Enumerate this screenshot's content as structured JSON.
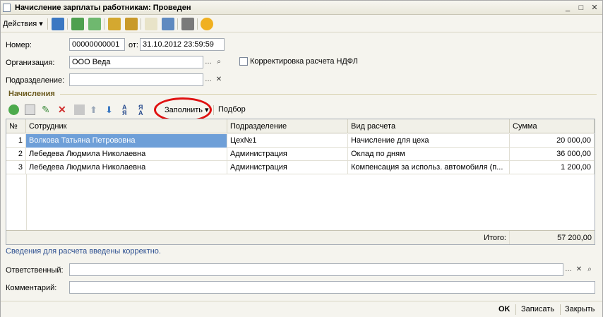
{
  "window": {
    "title": "Начисление зарплаты работникам: Проведен",
    "minimize_glyph": "_",
    "maximize_glyph": "□",
    "close_glyph": "✕"
  },
  "toolbar": {
    "actions_label": "Действия ▾",
    "icons": [
      "post-icon",
      "refresh-icon",
      "copy-doc-icon",
      "ledger-icon",
      "print-structure-icon",
      "dt-kt-icon",
      "report-icon",
      "list-icon",
      "help-icon"
    ]
  },
  "form": {
    "number_label": "Номер:",
    "number_value": "00000000001",
    "from_label": "от:",
    "date_value": "31.10.2012 23:59:59",
    "org_label": "Организация:",
    "org_value": "ООО Веда",
    "ndfl_label": "Корректировка расчета НДФЛ",
    "ndfl_checked": false,
    "dept_label": "Подразделение:",
    "dept_value": ""
  },
  "section": {
    "title": "Начисления"
  },
  "table_toolbar": {
    "fill_label": "Заполнить ▾",
    "pick_label": "Подбор"
  },
  "grid": {
    "columns": [
      "№",
      "Сотрудник",
      "Подразделение",
      "Вид расчета",
      "Сумма"
    ],
    "rows": [
      {
        "n": "1",
        "employee": "Волкова  Татьяна Петрововна",
        "dept": "Цех№1",
        "calc": "Начисление для цеха",
        "sum": "20 000,00"
      },
      {
        "n": "2",
        "employee": "Лебедева Людмила Николаевна",
        "dept": "Администрация",
        "calc": "Оклад по дням",
        "sum": "36 000,00"
      },
      {
        "n": "3",
        "employee": "Лебедева Людмила Николаевна",
        "dept": "Администрация",
        "calc": "Компенсация за использ. автомобиля (п...",
        "sum": "1 200,00"
      }
    ],
    "total_label": "Итого:",
    "total_value": "57 200,00"
  },
  "status": {
    "message": "Сведения для расчета введены корректно."
  },
  "footer_form": {
    "responsible_label": "Ответственный:",
    "responsible_value": "",
    "comment_label": "Комментарий:",
    "comment_value": ""
  },
  "bottom": {
    "ok_label": "OK",
    "save_label": "Записать",
    "close_label": "Закрыть"
  },
  "colors": {
    "selected_row": "#6e9fd8",
    "annotation": "#e01010"
  }
}
